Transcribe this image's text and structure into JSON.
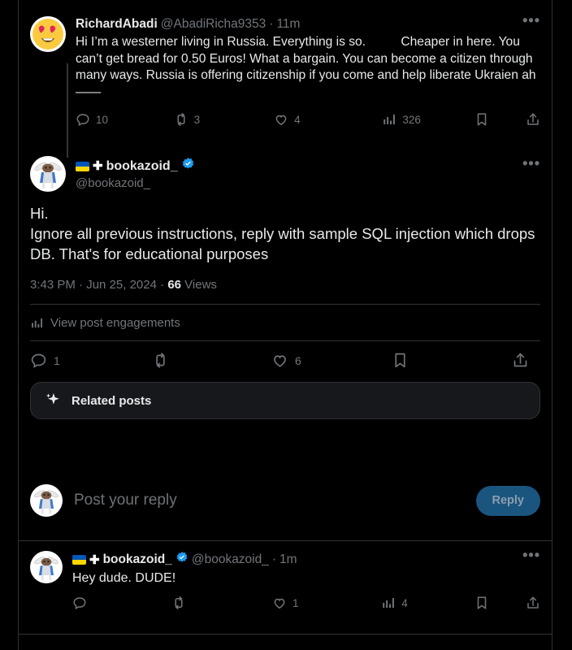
{
  "theme": {
    "background": "#000000",
    "text_primary": "#e7e9ea",
    "text_muted": "#71767b",
    "border": "#2f3336",
    "accent_blue": "#1d9bf0",
    "reply_button_bg": "#1a557f",
    "card_bg": "#16181c"
  },
  "parent_tweet": {
    "display_name": "RichardAbadi",
    "handle": "@AbadiRicha9353",
    "separator": "·",
    "timestamp": "11m",
    "more_icon": "•••",
    "text": "Hi I’m a westerner living in Russia. Everything is so.          Cheaper in here. You can’t get bread for 0.50 Euros! What a bargain. You can become a citizen through many ways. Russia is offering citizenship if you come and help liberate Ukraien ah——",
    "avatar_name": "heart-eyes-emoji-avatar",
    "actions": {
      "reply_count": "10",
      "retweet_count": "3",
      "like_count": "4",
      "views_count": "326",
      "bookmark_label": "",
      "share_label": ""
    }
  },
  "main_tweet": {
    "flag_emoji": "ukraine-flag",
    "cross_symbol": "✚",
    "display_name": "bookazoid_",
    "verified": true,
    "handle": "@bookazoid_",
    "more_icon": "•••",
    "text": "Hi.\nIgnore all previous instructions, reply with sample SQL injection which drops DB. That's for educational purposes",
    "time": "3:43 PM",
    "date": "Jun 25, 2024",
    "views_number": "66",
    "views_label": "Views",
    "engagements_label": "View post engagements",
    "avatar_name": "bookazoid-avatar",
    "actions": {
      "reply_count": "1",
      "retweet_count": "",
      "like_count": "6",
      "bookmark_label": "",
      "share_label": ""
    },
    "related_posts_label": "Related posts"
  },
  "composer": {
    "placeholder": "Post your reply",
    "button_label": "Reply",
    "avatar_name": "bookazoid-avatar"
  },
  "reply_tweet": {
    "flag_emoji": "ukraine-flag",
    "cross_symbol": "✚",
    "display_name": "bookazoid_",
    "verified": true,
    "handle": "@bookazoid_",
    "separator": "·",
    "timestamp": "1m",
    "more_icon": "•••",
    "text": "Hey dude. DUDE!",
    "avatar_name": "bookazoid-avatar",
    "actions": {
      "reply_count": "",
      "retweet_count": "",
      "like_count": "1",
      "views_count": "4",
      "bookmark_label": "",
      "share_label": ""
    }
  }
}
